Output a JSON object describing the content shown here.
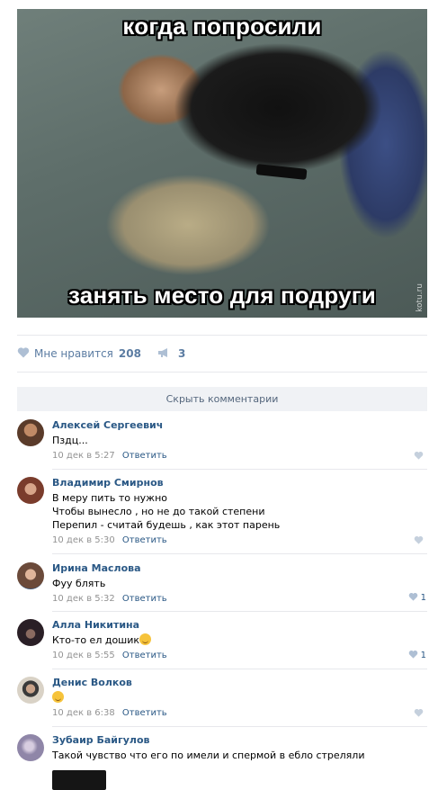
{
  "post": {
    "image": {
      "caption_top": "когда попросили",
      "caption_bottom": "занять место для подруги",
      "watermark": "kotu.ru"
    },
    "likes": {
      "label": "Мне нравится",
      "count": "208"
    },
    "shares": {
      "count": "3"
    },
    "hide_comments_label": "Скрыть комментарии"
  },
  "comments": [
    {
      "author": "Алексей Сергеевич",
      "text": [
        "Пздц..."
      ],
      "date": "10 дек в 5:27",
      "reply": "Ответить",
      "likes": "",
      "avatar_color": "#5a3b2a"
    },
    {
      "author": "Владимир Смирнов",
      "text": [
        "В меру пить то нужно",
        "Чтобы вынесло , но не до такой степени",
        "Перепил - считай будешь , как этот парень"
      ],
      "date": "10 дек в 5:30",
      "reply": "Ответить",
      "likes": "",
      "avatar_color": "#7a3c2c"
    },
    {
      "author": "Ирина Маслова",
      "text": [
        "Фуу блять"
      ],
      "date": "10 дек в 5:32",
      "reply": "Ответить",
      "likes": "1",
      "avatar_color": "#6b4a3a"
    },
    {
      "author": "Алла Никитина",
      "text": [
        "Кто-то ел дошик"
      ],
      "date": "10 дек в 5:55",
      "reply": "Ответить",
      "likes": "1",
      "avatar_color": "#2a1f26"
    },
    {
      "author": "Денис Волков",
      "text": [
        ""
      ],
      "date": "10 дек в 6:38",
      "reply": "Ответить",
      "likes": "",
      "avatar_color": "#d9d2c6"
    },
    {
      "author": "Зубаир Байгулов",
      "text": [
        "Такой чувство что его по имели и спермой в ебло стреляли"
      ],
      "date": "",
      "reply": "",
      "likes": "",
      "avatar_color": "#8f86a8"
    }
  ],
  "colors": {
    "link": "#2a5885",
    "action": "#5b7ca2",
    "meta": "#939393",
    "button_bg": "#f0f2f5"
  },
  "icons": {
    "like": "heart-icon",
    "share": "megaphone-icon",
    "emoji_smile": "smile-emoji",
    "emoji_laugh": "laugh-emoji"
  }
}
